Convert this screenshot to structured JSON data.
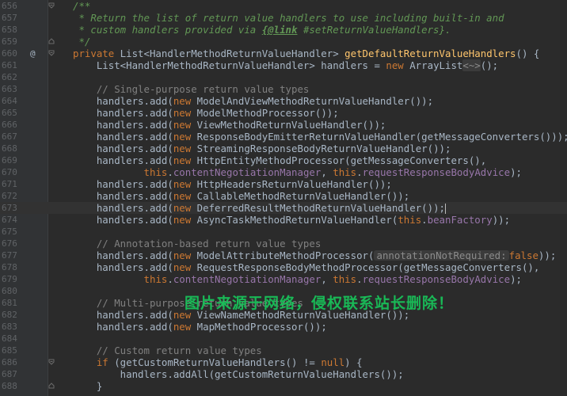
{
  "gutter": {
    "line_numbers": [
      "656",
      "657",
      "658",
      "659",
      "660",
      "661",
      "662",
      "663",
      "664",
      "665",
      "666",
      "667",
      "668",
      "669",
      "670",
      "671",
      "672",
      "673",
      "674",
      "675",
      "676",
      "677",
      "678",
      "679",
      "680",
      "681",
      "682",
      "683",
      "684",
      "685",
      "686",
      "687",
      "688"
    ],
    "override_marker": "@"
  },
  "code": {
    "l656": "/**",
    "l657_a": " * Return the list of return value handlers to use including built-in and",
    "l658_a": " * custom handlers provided via ",
    "l658_b": "{@link",
    "l658_c": " #setReturnValueHandlers}.",
    "l659": " */",
    "l660_kw": "private",
    "l660_a": " List<HandlerMethodReturnValueHandler> ",
    "l660_fn": "getDefaultReturnValueHandlers",
    "l660_b": "() {",
    "l661_a": "    List<HandlerMethodReturnValueHandler> handlers = ",
    "l661_kw": "new",
    "l661_b": " ArrayList",
    "l661_hint": "<~>",
    "l661_c": "();",
    "l663": "    // Single-purpose return value types",
    "call_prefix": "    handlers.add(",
    "new_kw": "new",
    "this_kw": "this",
    "l664": " ModelAndViewMethodReturnValueHandler());",
    "l665": " ModelMethodProcessor());",
    "l666": " ViewMethodReturnValueHandler());",
    "l667": " ResponseBodyEmitterReturnValueHandler(getMessageConverters()));",
    "l668": " StreamingResponseBodyReturnValueHandler());",
    "l669": " HttpEntityMethodProcessor(getMessageConverters(),",
    "cont_indent": "            ",
    "content_negotiation": "contentNegotiationManager",
    "comma_space": ", ",
    "request_advice": "requestResponseBodyAdvice",
    "dot": ".",
    "close_paren_semi": ");",
    "l671": " HttpHeadersReturnValueHandler());",
    "l672": " CallableMethodReturnValueHandler());",
    "l673": " DeferredResultMethodReturnValueHandler());",
    "l674_a": " AsyncTaskMethodReturnValueHandler(",
    "bean_factory": "beanFactory",
    "l674_b": "));",
    "l676": "    // Annotation-based return value types",
    "l677_a": " ModelAttributeMethodProcessor(",
    "l677_hint": "annotationNotRequired:",
    "l677_kw": "false",
    "l677_b": "));",
    "l678": " RequestResponseBodyMethodProcessor(getMessageConverters(),",
    "l681": "    // Multi-purpose return value types",
    "l682": " ViewNameMethodReturnValueHandler());",
    "l683": " MapMethodProcessor());",
    "l685": "    // Custom return value types",
    "l686_a": "    ",
    "l686_kw": "if",
    "l686_b": " (getCustomReturnValueHandlers() != ",
    "l686_null": "null",
    "l686_c": ") {",
    "l687": "        handlers.addAll(getCustomReturnValueHandlers());",
    "l688": "    }"
  },
  "watermark": "图片来源于网络，侵权联系站长删除！",
  "colors": {
    "background": "#2b2b2b",
    "keyword": "#cc7832",
    "method_decl": "#ffc66d",
    "field": "#9876aa",
    "doc_comment": "#629755",
    "line_comment": "#808080",
    "watermark": "#18c45a"
  }
}
